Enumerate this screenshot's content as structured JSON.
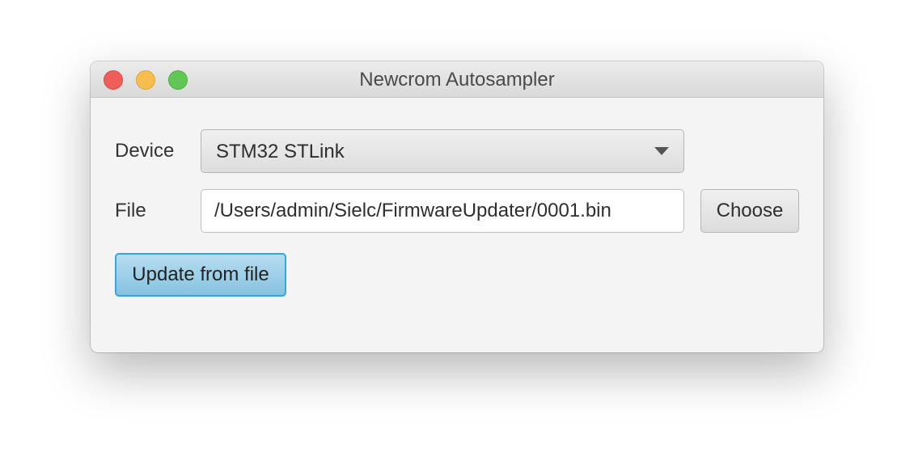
{
  "window": {
    "title": "Newcrom Autosampler"
  },
  "form": {
    "device_label": "Device",
    "device_value": "STM32 STLink",
    "file_label": "File",
    "file_value": "/Users/admin/Sielc/FirmwareUpdater/0001.bin",
    "choose_label": "Choose",
    "update_label": "Update from file"
  },
  "icons": {
    "close": "close-traffic-light-icon",
    "minimize": "minimize-traffic-light-icon",
    "zoom": "zoom-traffic-light-icon",
    "dropdown": "chevron-down-icon"
  },
  "colors": {
    "close": "#ee5f57",
    "minimize": "#f6be4f",
    "zoom": "#62c655",
    "accent": "#34a6e2"
  }
}
